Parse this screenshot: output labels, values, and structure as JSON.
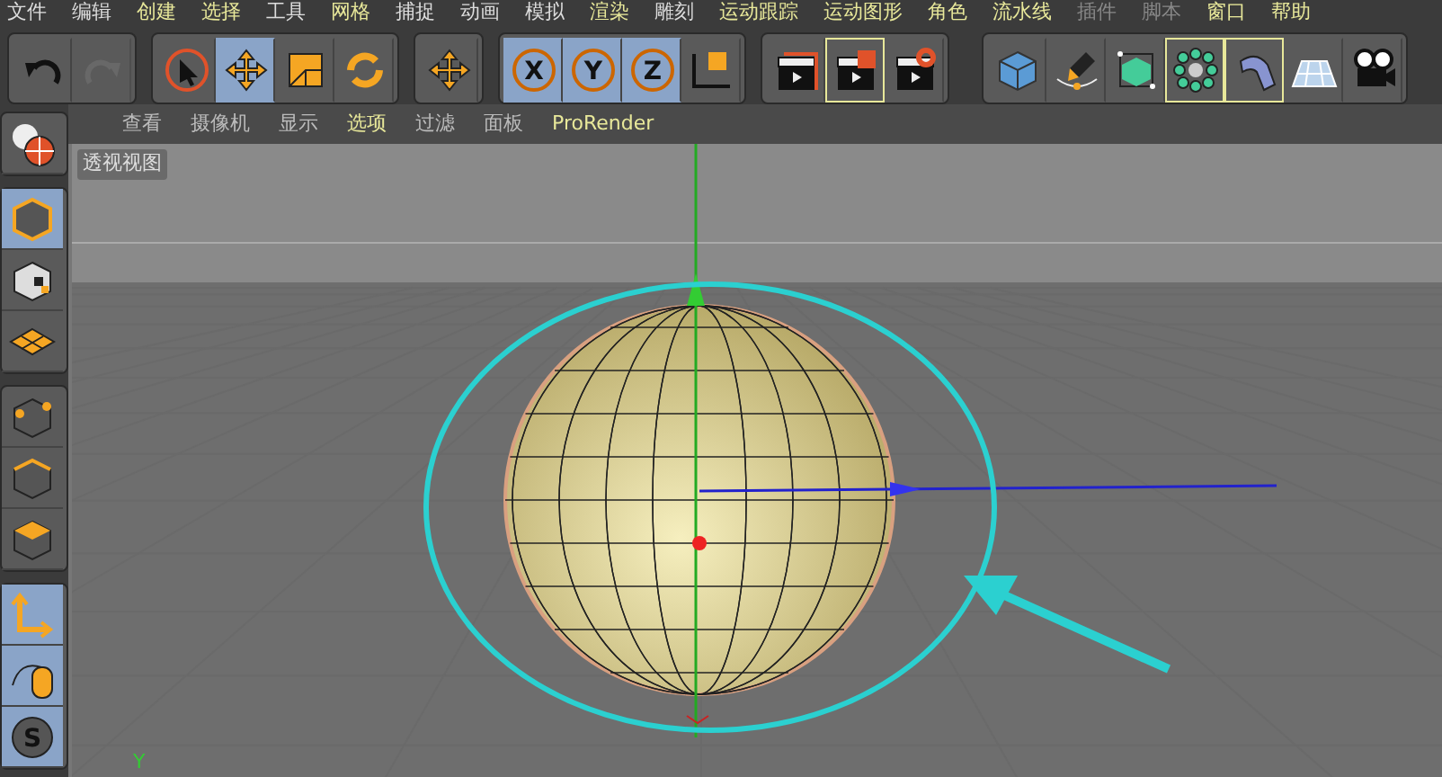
{
  "menu": [
    {
      "label": "文件",
      "highlighted": false,
      "disabled": false
    },
    {
      "label": "编辑",
      "highlighted": false,
      "disabled": false
    },
    {
      "label": "创建",
      "highlighted": true,
      "disabled": false
    },
    {
      "label": "选择",
      "highlighted": true,
      "disabled": false
    },
    {
      "label": "工具",
      "highlighted": false,
      "disabled": false
    },
    {
      "label": "网格",
      "highlighted": true,
      "disabled": false
    },
    {
      "label": "捕捉",
      "highlighted": false,
      "disabled": false
    },
    {
      "label": "动画",
      "highlighted": false,
      "disabled": false
    },
    {
      "label": "模拟",
      "highlighted": false,
      "disabled": false
    },
    {
      "label": "渲染",
      "highlighted": true,
      "disabled": false
    },
    {
      "label": "雕刻",
      "highlighted": false,
      "disabled": false
    },
    {
      "label": "运动跟踪",
      "highlighted": true,
      "disabled": false
    },
    {
      "label": "运动图形",
      "highlighted": true,
      "disabled": false
    },
    {
      "label": "角色",
      "highlighted": true,
      "disabled": false
    },
    {
      "label": "流水线",
      "highlighted": true,
      "disabled": false
    },
    {
      "label": "插件",
      "highlighted": false,
      "disabled": true
    },
    {
      "label": "脚本",
      "highlighted": false,
      "disabled": true
    },
    {
      "label": "窗口",
      "highlighted": true,
      "disabled": false
    },
    {
      "label": "帮助",
      "highlighted": true,
      "disabled": false
    }
  ],
  "toolbar": [
    [
      {
        "kind": "undo",
        "selected": false,
        "disabled": false
      },
      {
        "kind": "redo",
        "selected": false,
        "disabled": true
      }
    ],
    [
      {
        "kind": "select",
        "selected": false,
        "disabled": false
      },
      {
        "kind": "move",
        "selected": true,
        "disabled": false
      },
      {
        "kind": "scale",
        "selected": false,
        "disabled": false
      },
      {
        "kind": "rotate",
        "selected": false,
        "disabled": false
      }
    ],
    [
      {
        "kind": "move",
        "selected": false,
        "disabled": false
      }
    ],
    [
      {
        "kind": "axislock",
        "label": "X",
        "selected": true,
        "disabled": false
      },
      {
        "kind": "axislock",
        "label": "Y",
        "selected": true,
        "disabled": false
      },
      {
        "kind": "axislock",
        "label": "Z",
        "selected": true,
        "disabled": false
      },
      {
        "kind": "coords",
        "selected": false,
        "disabled": false
      }
    ],
    [
      {
        "kind": "renderview",
        "selected": false,
        "disabled": false
      },
      {
        "kind": "renderpic",
        "selected": true,
        "disabled": false
      },
      {
        "kind": "rendersettings",
        "selected": false,
        "disabled": false
      }
    ],
    [
      {
        "kind": "cube",
        "selected": false,
        "disabled": false
      },
      {
        "kind": "pen",
        "selected": false,
        "disabled": false
      },
      {
        "kind": "subdiv",
        "selected": false,
        "disabled": false
      },
      {
        "kind": "cloner",
        "selected": true,
        "disabled": false
      },
      {
        "kind": "bend",
        "selected": true,
        "disabled": false
      },
      {
        "kind": "floor",
        "selected": false,
        "disabled": false
      },
      {
        "kind": "camera",
        "selected": false,
        "disabled": false
      }
    ]
  ],
  "sidebar": [
    [
      {
        "kind": "editable",
        "selected": false
      }
    ],
    [
      {
        "kind": "model",
        "selected": true
      },
      {
        "kind": "texture",
        "selected": false
      },
      {
        "kind": "workplane",
        "selected": false
      }
    ],
    [
      {
        "kind": "points",
        "selected": false
      },
      {
        "kind": "edges",
        "selected": false
      },
      {
        "kind": "polygons",
        "selected": false
      }
    ],
    [
      {
        "kind": "axis",
        "selected": true
      },
      {
        "kind": "tweak",
        "selected": true
      },
      {
        "kind": "snap",
        "label": "S",
        "selected": true
      }
    ]
  ],
  "viewport": {
    "menu": [
      {
        "label": "查看",
        "highlighted": false
      },
      {
        "label": "摄像机",
        "highlighted": false
      },
      {
        "label": "显示",
        "highlighted": false
      },
      {
        "label": "选项",
        "highlighted": true
      },
      {
        "label": "过滤",
        "highlighted": false
      },
      {
        "label": "面板",
        "highlighted": false
      },
      {
        "label": "ProRender",
        "highlighted": true
      }
    ],
    "title": "透视视图",
    "axis_label": "Y"
  }
}
